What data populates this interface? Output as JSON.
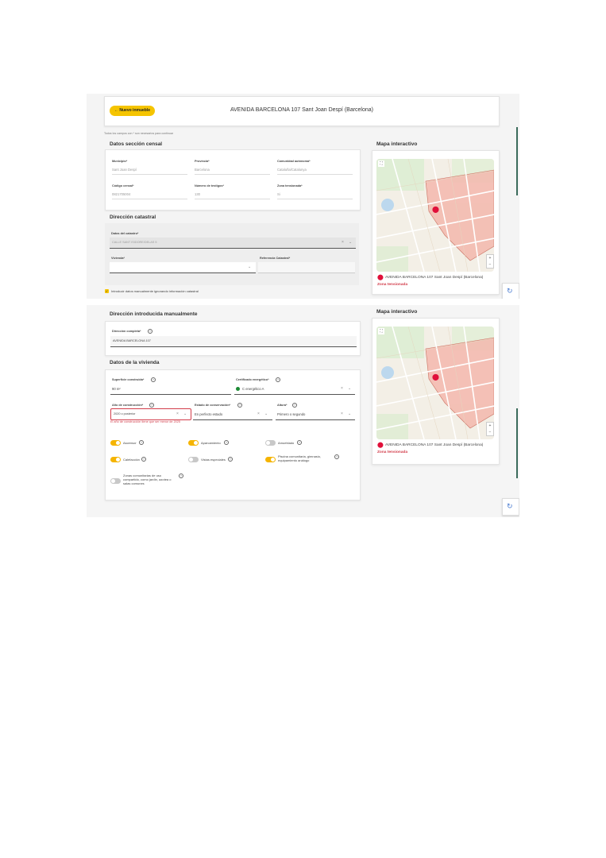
{
  "header": {
    "back_label": "Nuevo inmueble",
    "title": "AVENIDA BARCELONA 107 Sant Joan Despí (Barcelona)"
  },
  "required_note": "Todos los campos con * son necesarios para continuar",
  "censal": {
    "title": "Datos sección censal",
    "municipio_label": "Municipio*",
    "municipio_value": "Sant Joan Despí",
    "provincia_label": "Provincia*",
    "provincia_value": "Barcelona",
    "comunidad_label": "Comunidad autónoma*",
    "comunidad_value": "Cataluña/Catalunya",
    "censal_label": "Código censal*",
    "censal_value": "0821705004",
    "testigos_label": "Número de testigos*",
    "testigos_value": "130",
    "zona_label": "Zona tensionada*",
    "zona_value": "Si"
  },
  "catastral": {
    "title": "Dirección catastral",
    "datos_label": "Datos del catastro*",
    "datos_value": "CALLE SANT ISIDORE/DELAS 5",
    "vivienda_label": "Vivienda*",
    "ref_label": "Referencia Catastral*",
    "manual_checkbox_label": "Introducir datos manualmente ignorando información catastral"
  },
  "manual": {
    "title": "Dirección introducida manualmente",
    "direccion_label": "Dirección completa*",
    "direccion_value": "AVENIDA BARCELONA 107"
  },
  "vivienda": {
    "title": "Datos de la vivienda",
    "superficie_label": "Superficie construida*",
    "superficie_value": "90 m²",
    "certificado_label": "Certificado energético*",
    "certificado_value": "C energético A",
    "anio_label": "Año de construcción*",
    "anio_value": "2020 o posterior",
    "estado_label": "Estado de conservación*",
    "estado_value": "En perfecto estado",
    "altura_label": "Altura*",
    "altura_value": "Primero o segundo",
    "anio_error": "El año de construcción tiene que ser menor de 2025",
    "toggles": [
      {
        "label": "Ascensor",
        "on": true
      },
      {
        "label": "Aparcamiento",
        "on": true
      },
      {
        "label": "Amueblado",
        "on": false
      },
      {
        "label": "Calefacción",
        "on": true
      },
      {
        "label": "Vistas especiales",
        "on": false
      },
      {
        "label": "Piscina comunitaria, gimnasio, equipamiento análogo",
        "on": true
      },
      {
        "label": "Zonas comunitarias de uso compartido, como jardín, azotea o salas comunes",
        "on": false
      }
    ]
  },
  "map": {
    "title": "Mapa interactivo",
    "address": "AVENIDA BARCELONA 107 Sant Joan Despí (Barcelona)",
    "zona": "Zona tensionada",
    "zoom_in": "+",
    "zoom_out": "−"
  },
  "colors": {
    "accent": "#f5c400",
    "zona": "#d23c4a",
    "map_zone_fill": "#f4b8ad",
    "map_bg": "#f3efe6"
  },
  "icons": [
    "arrow-left-icon",
    "help-icon",
    "close-icon",
    "chevron-down-icon",
    "location-pin-icon",
    "checkbox-icon",
    "recaptcha-icon",
    "fullscreen-icon"
  ]
}
